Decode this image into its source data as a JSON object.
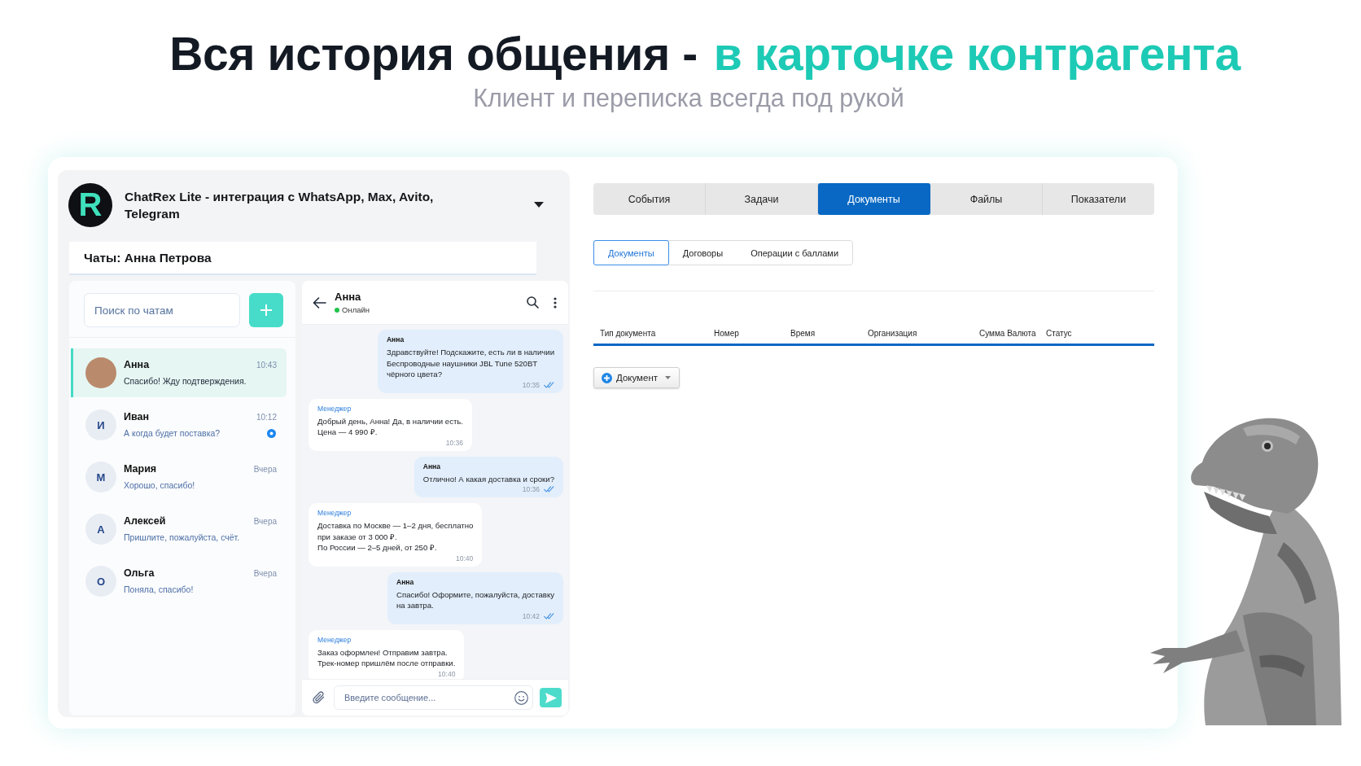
{
  "headline": {
    "lead": "Вся история общения -",
    "accent": "в карточке контрагента"
  },
  "subtitle": "Клиент и переписка всегда под рукой",
  "app": {
    "logo_text": "R",
    "title": "ChatRex Lite - интеграция с WhatsApp, Max, Avito, Telegram",
    "chats_title": "Чаты: Анна Петрова"
  },
  "chat_list": {
    "search": {
      "placeholder": "Поиск по чатам"
    },
    "chats": [
      {
        "kind": "photo",
        "name": "Анна",
        "time": "10:43",
        "preview": "Спасибо! Жду подтверждения.",
        "selected": true,
        "unread": false
      },
      {
        "kind": "initial",
        "initial": "И",
        "name": "Иван",
        "time": "10:12",
        "preview": "А когда будет поставка?",
        "selected": false,
        "unread": true
      },
      {
        "kind": "initial",
        "initial": "М",
        "name": "Мария",
        "time": "Вчера",
        "preview": "Хорошо, спасибо!",
        "selected": false,
        "unread": false
      },
      {
        "kind": "initial",
        "initial": "А",
        "name": "Алексей",
        "time": "Вчера",
        "preview": "Пришлите, пожалуйста, счёт.",
        "selected": false,
        "unread": false
      },
      {
        "kind": "initial",
        "initial": "О",
        "name": "Ольга",
        "time": "Вчера",
        "preview": "Поняла, спасибо!",
        "selected": false,
        "unread": false
      }
    ]
  },
  "conversation": {
    "contact": "Анна",
    "status": "Онлайн",
    "online": true,
    "messages": [
      {
        "kind": "outgoing",
        "author": "Анна",
        "text": "Здравствуйте! Подскажите, есть ли в наличии\nБеспроводные наушники JBL Tune 520BT\nчёрного цвета?",
        "time": "10:35",
        "read": true
      },
      {
        "kind": "incoming",
        "author": "Менеджер",
        "text": "Добрый день, Анна! Да, в наличии есть.\nЦена — 4 990 ₽.",
        "time": "10:36"
      },
      {
        "kind": "outgoing",
        "author": "Анна",
        "text": "Отлично! А какая доставка и сроки?",
        "time": "10:36",
        "read": true
      },
      {
        "kind": "incoming",
        "author": "Менеджер",
        "text": "Доставка по Москве — 1–2 дня, бесплатно\nпри заказе от 3 000 ₽.\nПо России — 2–5 дней, от 250 ₽.",
        "time": "10:40"
      },
      {
        "kind": "outgoing",
        "author": "Анна",
        "text": "Спасибо! Оформите, пожалуйста, доставку\nна завтра.",
        "time": "10:42",
        "read": true
      },
      {
        "kind": "incoming",
        "author": "Менеджер",
        "text": "Заказ оформлен! Отправим завтра.\nТрек-номер пришлём после отправки.",
        "time": "10:40"
      }
    ],
    "composer": {
      "placeholder": "Введите сообщение..."
    }
  },
  "record_card": {
    "tabs": [
      {
        "label": "События",
        "selected": false
      },
      {
        "label": "Задачи",
        "selected": false
      },
      {
        "label": "Документы",
        "selected": true
      },
      {
        "label": "Файлы",
        "selected": false
      },
      {
        "label": "Показатели",
        "selected": false
      }
    ],
    "subtabs": [
      {
        "label": "Документы",
        "selected": true
      },
      {
        "label": "Договоры",
        "selected": false
      },
      {
        "label": "Операции с баллами",
        "selected": false
      }
    ],
    "table": {
      "columns": [
        "Тип документа",
        "Номер",
        "Время",
        "Организация",
        "Сумма Валюта",
        "Статус"
      ]
    },
    "add_button": {
      "label": "Документ"
    }
  }
}
